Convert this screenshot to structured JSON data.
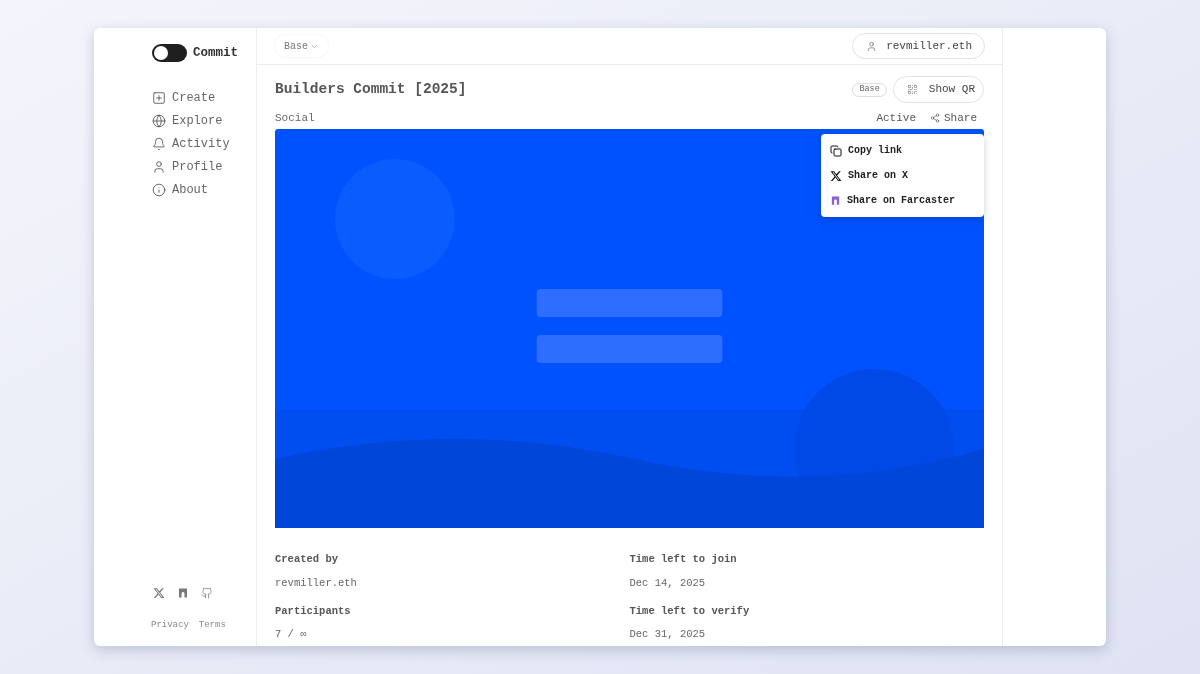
{
  "brand": {
    "name": "Commit"
  },
  "sidebar": {
    "items": [
      {
        "kind": "create",
        "label": "Create"
      },
      {
        "kind": "explore",
        "label": "Explore"
      },
      {
        "kind": "activity",
        "label": "Activity"
      },
      {
        "kind": "profile",
        "label": "Profile"
      },
      {
        "kind": "about",
        "label": "About"
      }
    ],
    "social": [
      {
        "kind": "x"
      },
      {
        "kind": "farcaster"
      },
      {
        "kind": "github"
      }
    ],
    "footer_links": [
      "Privacy",
      "Terms"
    ]
  },
  "topbar": {
    "network": "Base",
    "account": "revmiller.eth"
  },
  "commit": {
    "title": "Builders Commit [2025]",
    "network_badge": "Base",
    "qr_button": "Show QR",
    "category": "Social",
    "status": "Active",
    "share_button": "Share",
    "details": [
      {
        "label": "Created by",
        "value": "revmiller.eth"
      },
      {
        "label": "Time left to join",
        "value": "Dec 14, 2025"
      },
      {
        "label": "Participants",
        "value": "7 / ∞"
      },
      {
        "label": "Time left to verify",
        "value": "Dec 31, 2025"
      }
    ]
  },
  "share_menu": {
    "items": [
      {
        "kind": "copy",
        "label": "Copy link"
      },
      {
        "kind": "x",
        "label": "Share on X"
      },
      {
        "kind": "farcaster",
        "label": "Share on Farcaster"
      }
    ]
  }
}
